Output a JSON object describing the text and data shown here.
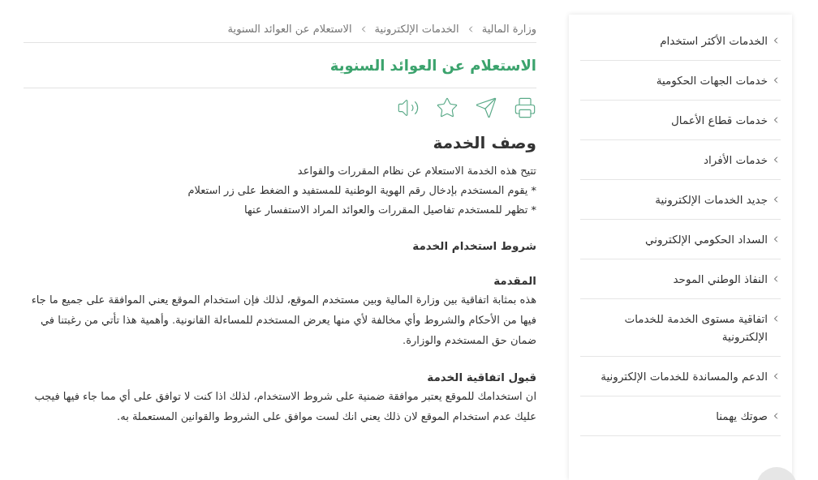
{
  "breadcrumbs": [
    "وزارة المالية",
    "الخدمات الإلكترونية",
    "الاستعلام عن العوائد السنوية"
  ],
  "page_title": "الاستعلام عن العوائد السنوية",
  "section_title": "وصف الخدمة",
  "description": [
    "تتيح هذه الخدمة الاستعلام عن نظام المقررات والقواعد",
    "* يقوم المستخدم بإدخال رقم الهوية الوطنية للمستفيد و الضغط على زر استعلام",
    "* تظهر للمستخدم تفاصيل المقررات والعوائد المراد الاستفسار عنها"
  ],
  "terms_title": "شروط استخدام الخدمة",
  "terms": [
    {
      "heading": "المقدمة",
      "text": "هذه بمثابة اتفاقية بين وزارة المالية وبين مستخدم الموقع، لذلك فإن استخدام الموقع يعني الموافقة على جميع ما جاء فيها من الأحكام والشروط وأي مخالفة لأي منها يعرض المستخدم للمساءلة القانونية. وأهمية هذا تأتي من رغبتنا في ضمان حق المستخدم والوزارة."
    },
    {
      "heading": "قبول اتفاقية الخدمة",
      "text": "ان استخدامك للموقع يعتبر موافقة ضمنية على شروط الاستخدام، لذلك اذا كنت لا توافق على أي مما جاء فيها فيجب عليك عدم استخدام الموقع لان ذلك يعني انك لست موافق على الشروط والقوانين المستعملة به."
    }
  ],
  "sidebar": {
    "items": [
      "الخدمات الأكثر استخدام",
      "خدمات الجهات الحكومية",
      "خدمات قطاع الأعمال",
      "خدمات الأفراد",
      "جديد الخدمات الإلكترونية",
      "السداد الحكومي الإلكتروني",
      "النفاذ الوطني الموحد",
      "اتفاقية مستوى الخدمة للخدمات الإلكترونية",
      "الدعم والمساندة للخدمات الإلكترونية",
      "صوتك يهمنا"
    ]
  }
}
